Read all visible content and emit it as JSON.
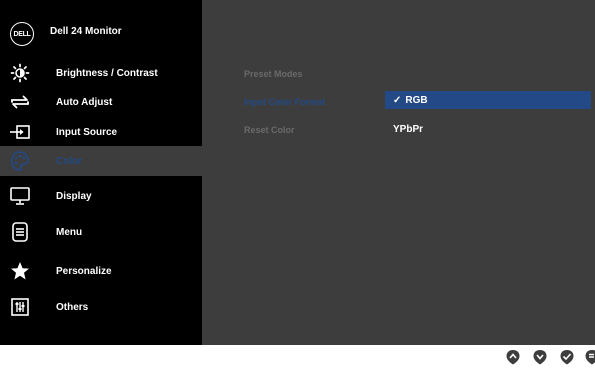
{
  "header": {
    "logo_text": "DELL",
    "model": "Dell 24 Monitor"
  },
  "menu": [
    {
      "label": "Brightness / Contrast",
      "icon": "brightness-icon"
    },
    {
      "label": "Auto Adjust",
      "icon": "auto-adjust-icon"
    },
    {
      "label": "Input Source",
      "icon": "input-source-icon"
    },
    {
      "label": "Color",
      "icon": "color-palette-icon",
      "active": true
    },
    {
      "label": "Display",
      "icon": "display-icon"
    },
    {
      "label": "Menu",
      "icon": "menu-icon"
    },
    {
      "label": "Personalize",
      "icon": "star-icon"
    },
    {
      "label": "Others",
      "icon": "others-icon"
    }
  ],
  "submenu": [
    {
      "label": "Preset Modes"
    },
    {
      "label": "Input Color Format",
      "selected": true
    },
    {
      "label": "Reset Color"
    }
  ],
  "options": [
    {
      "label": "RGB",
      "checked": true,
      "check_mark": "✓"
    },
    {
      "label": "YPbPr"
    }
  ],
  "colors": {
    "sidebar_bg": "#000000",
    "content_bg": "#3d3d3d",
    "accent": "#234a86"
  },
  "buttons": [
    "up-arrow-icon",
    "down-arrow-icon",
    "ok-check-icon",
    "back-icon"
  ]
}
